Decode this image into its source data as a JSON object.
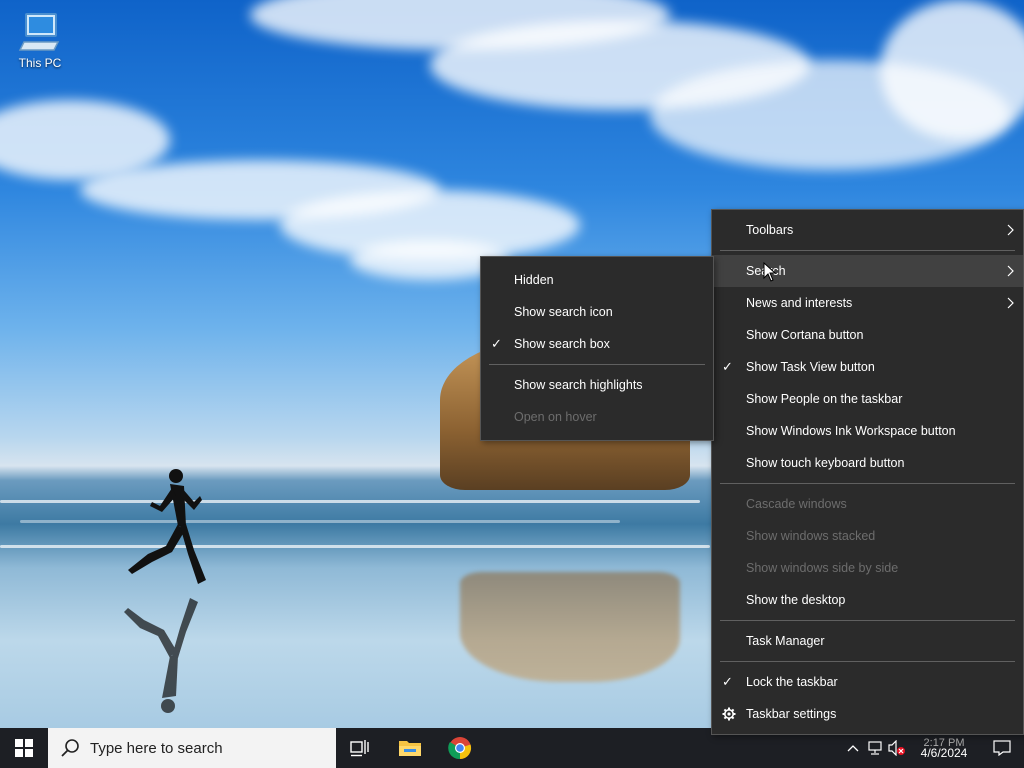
{
  "desktop": {
    "icons": [
      {
        "label": "This PC",
        "icon": "computer-icon"
      }
    ]
  },
  "taskbar": {
    "start_icon": "windows-logo-icon",
    "search_placeholder": "Type here to search",
    "pinned": [
      {
        "name": "Task View",
        "icon": "task-view-icon"
      },
      {
        "name": "File Explorer",
        "icon": "folder-icon"
      },
      {
        "name": "Google Chrome",
        "icon": "chrome-icon"
      }
    ],
    "tray": {
      "clock_time": "2:17 PM",
      "clock_date": "4/6/2024",
      "icons": [
        "chevron-up-icon",
        "network-icon",
        "volume-muted-icon",
        "notifications-icon"
      ]
    }
  },
  "context_menu": {
    "items": [
      {
        "label": "Toolbars",
        "submenu": true
      },
      {
        "separator": true
      },
      {
        "label": "Search",
        "submenu": true,
        "highlighted": true
      },
      {
        "label": "News and interests",
        "submenu": true
      },
      {
        "label": "Show Cortana button"
      },
      {
        "label": "Show Task View button",
        "checked": true
      },
      {
        "label": "Show People on the taskbar"
      },
      {
        "label": "Show Windows Ink Workspace button"
      },
      {
        "label": "Show touch keyboard button"
      },
      {
        "separator": true
      },
      {
        "label": "Cascade windows",
        "disabled": true
      },
      {
        "label": "Show windows stacked",
        "disabled": true
      },
      {
        "label": "Show windows side by side",
        "disabled": true
      },
      {
        "label": "Show the desktop"
      },
      {
        "separator": true
      },
      {
        "label": "Task Manager"
      },
      {
        "separator": true
      },
      {
        "label": "Lock the taskbar",
        "checked": true
      },
      {
        "label": "Taskbar settings",
        "icon": "gear-icon"
      }
    ]
  },
  "search_submenu": {
    "items": [
      {
        "label": "Hidden"
      },
      {
        "label": "Show search icon"
      },
      {
        "label": "Show search box",
        "checked": true
      },
      {
        "separator": true
      },
      {
        "label": "Show search highlights"
      },
      {
        "label": "Open on hover",
        "disabled": true
      }
    ]
  },
  "colors": {
    "menu_bg": "#2b2b2b",
    "menu_hover": "#414141",
    "taskbar_bg": "#1d1f24",
    "disabled_text": "#6d6d6d"
  }
}
